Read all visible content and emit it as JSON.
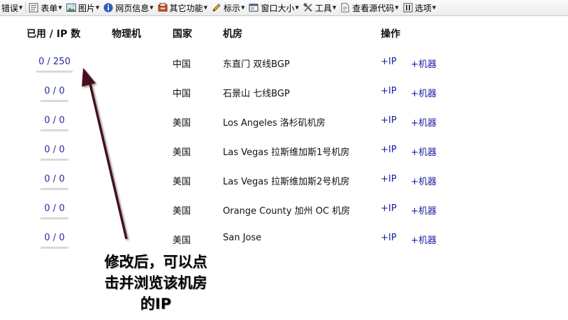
{
  "toolbar": {
    "items": [
      {
        "label": "错误",
        "icon": "error-icon",
        "caret": true
      },
      {
        "label": "表单",
        "icon": "form-icon",
        "caret": true
      },
      {
        "label": "图片",
        "icon": "image-icon",
        "caret": true
      },
      {
        "label": "网页信息",
        "icon": "info-icon",
        "caret": true
      },
      {
        "label": "其它功能",
        "icon": "misc-icon",
        "caret": true
      },
      {
        "label": "标示",
        "icon": "pencil-icon",
        "caret": true
      },
      {
        "label": "窗口大小",
        "icon": "window-icon",
        "caret": true
      },
      {
        "label": "工具",
        "icon": "tools-icon",
        "caret": true
      },
      {
        "label": "查看源代码",
        "icon": "source-icon",
        "caret": true
      },
      {
        "label": "选项",
        "icon": "options-icon",
        "caret": true
      }
    ]
  },
  "table": {
    "headers": {
      "used_ip": "已用 / IP 数",
      "server": "物理机",
      "country": "国家",
      "datacenter": "机房",
      "actions": "操作"
    },
    "rows": [
      {
        "used": "0 / 250",
        "country": "中国",
        "datacenter": "东直门 双线BGP",
        "add_ip": "+IP",
        "add_machine": "+机器"
      },
      {
        "used": "0 / 0",
        "country": "中国",
        "datacenter": "石景山 七线BGP",
        "add_ip": "+IP",
        "add_machine": "+机器"
      },
      {
        "used": "0 / 0",
        "country": "美国",
        "datacenter": "Los Angeles 洛杉矶机房",
        "add_ip": "+IP",
        "add_machine": "+机器"
      },
      {
        "used": "0 / 0",
        "country": "美国",
        "datacenter": "Las Vegas 拉斯维加斯1号机房",
        "add_ip": "+IP",
        "add_machine": "+机器"
      },
      {
        "used": "0 / 0",
        "country": "美国",
        "datacenter": "Las Vegas 拉斯维加斯2号机房",
        "add_ip": "+IP",
        "add_machine": "+机器"
      },
      {
        "used": "0 / 0",
        "country": "美国",
        "datacenter": "Orange County 加州 OC 机房",
        "add_ip": "+IP",
        "add_machine": "+机器"
      },
      {
        "used": "0 / 0",
        "country": "美国",
        "datacenter": "San Jose",
        "add_ip": "+IP",
        "add_machine": "+机器"
      }
    ]
  },
  "annotation": {
    "text_line1": "修改后，可以点",
    "text_line2": "击并浏览该机房",
    "text_line3": "的IP",
    "arrow_color": "#4a0f1a"
  }
}
